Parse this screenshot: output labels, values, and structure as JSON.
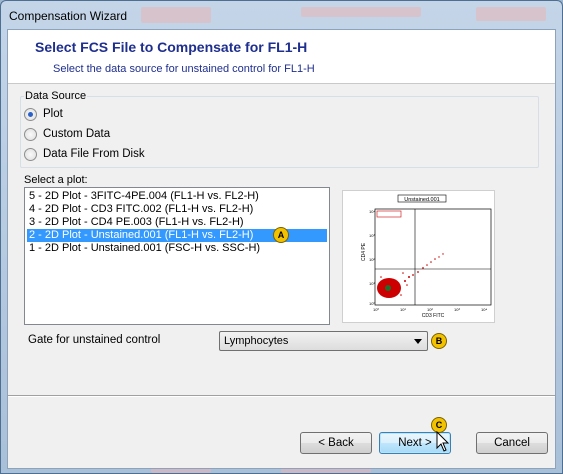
{
  "window": {
    "title": "Compensation Wizard"
  },
  "header": {
    "title": "Select FCS File to Compensate for FL1-H",
    "subtitle": "Select the data source for unstained control for FL1-H"
  },
  "data_source": {
    "label": "Data Source",
    "options": [
      {
        "label": "Plot",
        "checked": true
      },
      {
        "label": "Custom Data",
        "checked": false
      },
      {
        "label": "Data File From Disk",
        "checked": false
      }
    ]
  },
  "plot_list": {
    "label": "Select a plot:",
    "items": [
      "5 - 2D Plot - 3FITC-4PE.004 (FL1-H vs. FL2-H)",
      "4 - 2D Plot - CD3 FITC.002 (FL1-H vs. FL2-H)",
      "3 - 2D Plot - CD4 PE.003 (FL1-H vs. FL2-H)",
      "2 - 2D Plot - Unstained.001 (FL1-H vs. FL2-H)",
      "1 - 2D Plot - Unstained.001 (FSC-H vs. SSC-H)"
    ],
    "selected_index": 3
  },
  "preview": {
    "title": "Unstained.001",
    "y_axis": "CD4 PE",
    "x_axis": "CD3 FITC"
  },
  "gate": {
    "label": "Gate for unstained control",
    "value": "Lymphocytes"
  },
  "badges": {
    "a": "A",
    "b": "B",
    "c": "C"
  },
  "buttons": {
    "back": "Back",
    "next": "Next",
    "cancel": "Cancel"
  },
  "colors": {
    "selection": "#3399ff",
    "header_text": "#1f2f8e",
    "badge": "#f2c200",
    "dot": "#cc0000"
  }
}
